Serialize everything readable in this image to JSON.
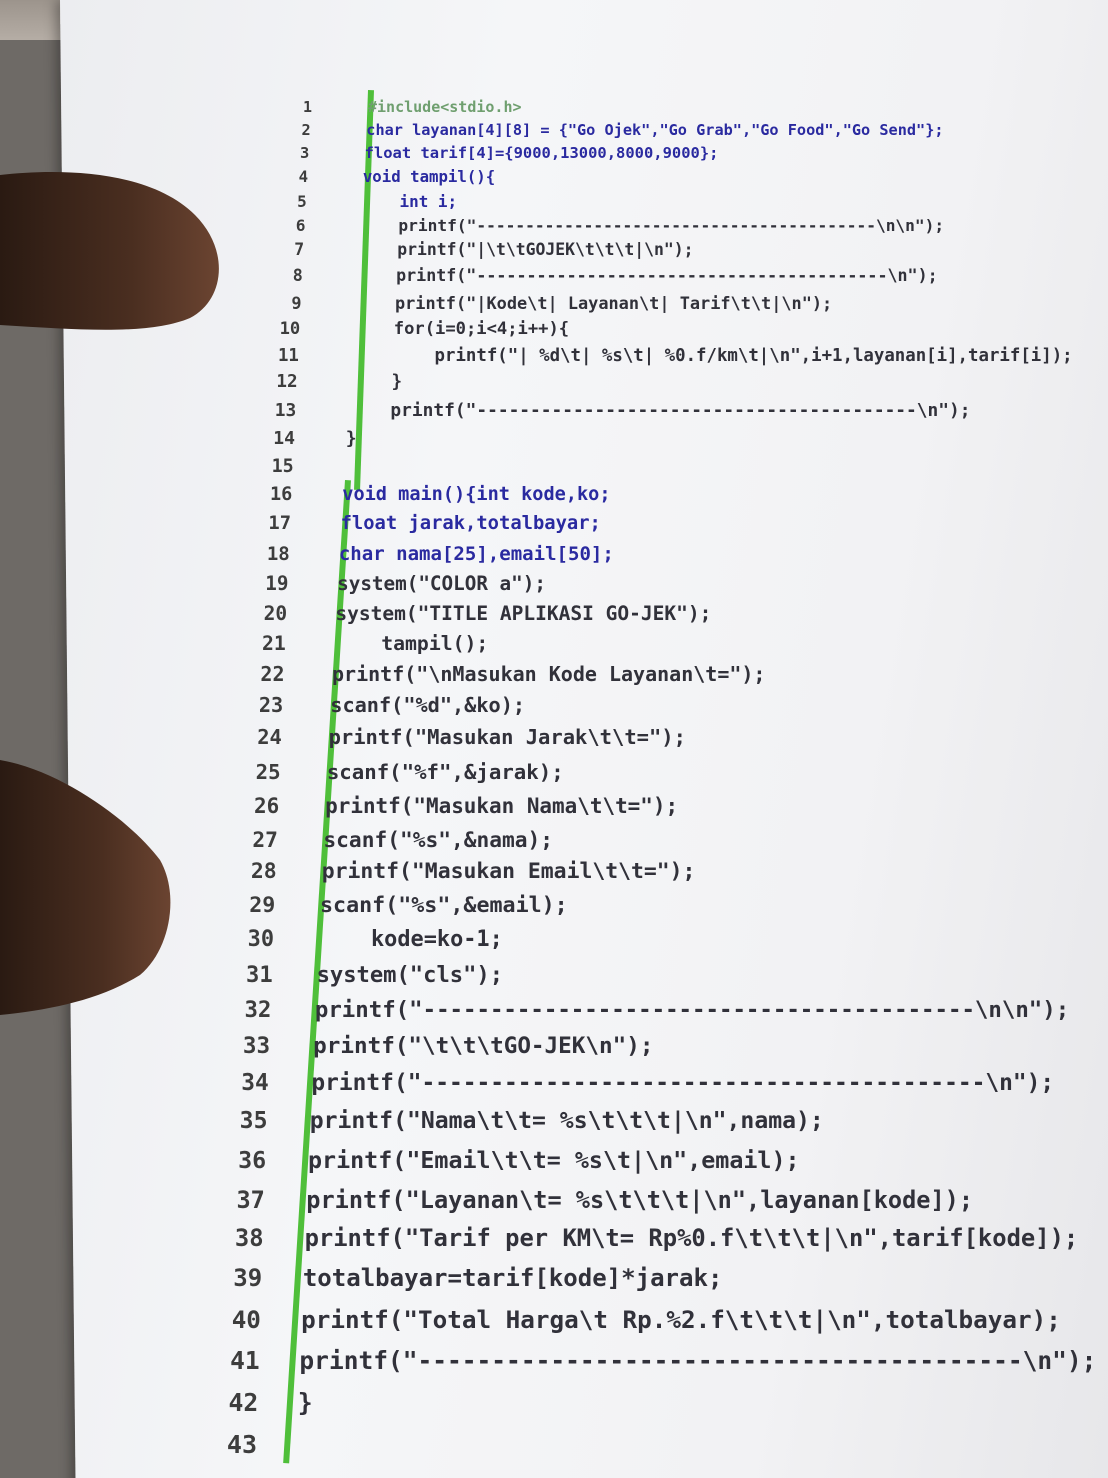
{
  "code": {
    "lines": [
      {
        "n": "1",
        "text": "#include<stdio.h>"
      },
      {
        "n": "2",
        "text": "char layanan[4][8] = {\"Go Ojek\",\"Go Grab\",\"Go Food\",\"Go Send\"};"
      },
      {
        "n": "3",
        "text": "float tarif[4]={9000,13000,8000,9000};"
      },
      {
        "n": "4",
        "text": "void tampil(){"
      },
      {
        "n": "5",
        "text": "    int i;"
      },
      {
        "n": "6",
        "text": "    printf(\"-----------------------------------------\\n\\n\");"
      },
      {
        "n": "7",
        "text": "    printf(\"|\\t\\tGOJEK\\t\\t\\t|\\n\");"
      },
      {
        "n": "8",
        "text": "    printf(\"-----------------------------------------\\n\");"
      },
      {
        "n": "9",
        "text": "    printf(\"|Kode\\t| Layanan\\t| Tarif\\t\\t|\\n\");"
      },
      {
        "n": "10",
        "text": "    for(i=0;i<4;i++){"
      },
      {
        "n": "11",
        "text": "        printf(\"| %d\\t| %s\\t| %0.f/km\\t|\\n\",i+1,layanan[i],tarif[i]);"
      },
      {
        "n": "12",
        "text": "    }"
      },
      {
        "n": "13",
        "text": "    printf(\"-----------------------------------------\\n\");"
      },
      {
        "n": "14",
        "text": "}"
      },
      {
        "n": "15",
        "text": ""
      },
      {
        "n": "16",
        "text": "void main(){int kode,ko;"
      },
      {
        "n": "17",
        "text": "float jarak,totalbayar;"
      },
      {
        "n": "18",
        "text": "char nama[25],email[50];"
      },
      {
        "n": "19",
        "text": "system(\"COLOR a\");"
      },
      {
        "n": "20",
        "text": "system(\"TITLE APLIKASI GO-JEK\");"
      },
      {
        "n": "21",
        "text": "    tampil();"
      },
      {
        "n": "22",
        "text": "printf(\"\\nMasukan Kode Layanan\\t=\");"
      },
      {
        "n": "23",
        "text": "scanf(\"%d\",&ko);"
      },
      {
        "n": "24",
        "text": "printf(\"Masukan Jarak\\t\\t=\");"
      },
      {
        "n": "25",
        "text": "scanf(\"%f\",&jarak);"
      },
      {
        "n": "26",
        "text": "printf(\"Masukan Nama\\t\\t=\");"
      },
      {
        "n": "27",
        "text": "scanf(\"%s\",&nama);"
      },
      {
        "n": "28",
        "text": "printf(\"Masukan Email\\t\\t=\");"
      },
      {
        "n": "29",
        "text": "scanf(\"%s\",&email);"
      },
      {
        "n": "30",
        "text": "    kode=ko-1;"
      },
      {
        "n": "31",
        "text": "system(\"cls\");"
      },
      {
        "n": "32",
        "text": "printf(\"-----------------------------------------\\n\\n\");"
      },
      {
        "n": "33",
        "text": "printf(\"\\t\\t\\tGO-JEK\\n\");"
      },
      {
        "n": "34",
        "text": "printf(\"-----------------------------------------\\n\");"
      },
      {
        "n": "35",
        "text": "printf(\"Nama\\t\\t= %s\\t\\t\\t|\\n\",nama);"
      },
      {
        "n": "36",
        "text": "printf(\"Email\\t\\t= %s\\t|\\n\",email);"
      },
      {
        "n": "37",
        "text": "printf(\"Layanan\\t= %s\\t\\t\\t|\\n\",layanan[kode]);"
      },
      {
        "n": "38",
        "text": "printf(\"Tarif per KM\\t= Rp%0.f\\t\\t\\t|\\n\",tarif[kode]);"
      },
      {
        "n": "39",
        "text": "totalbayar=tarif[kode]*jarak;"
      },
      {
        "n": "40",
        "text": "printf(\"Total Harga\\t Rp.%2.f\\t\\t\\t|\\n\",totalbayar);"
      },
      {
        "n": "41",
        "text": "printf(\"-----------------------------------------\\n\");"
      },
      {
        "n": "42",
        "text": "}"
      },
      {
        "n": "43",
        "text": ""
      }
    ]
  }
}
